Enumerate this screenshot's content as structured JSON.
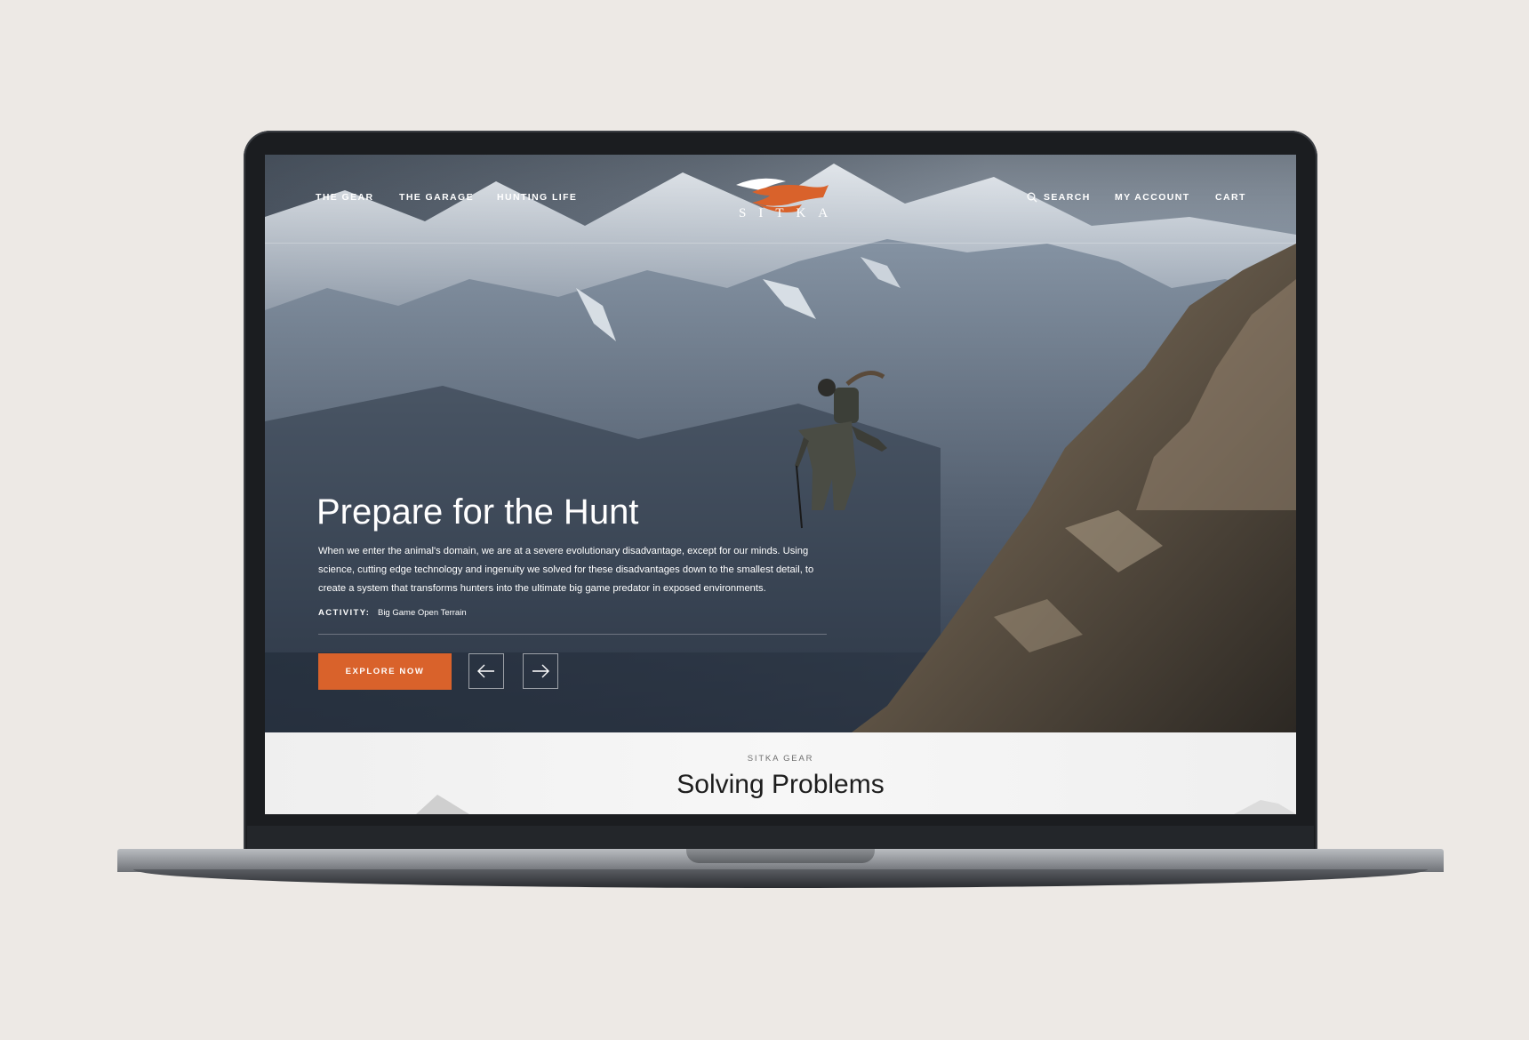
{
  "colors": {
    "accent": "#d9622b",
    "page_background": "#ede9e5"
  },
  "nav": {
    "left": [
      {
        "label": "THE GEAR"
      },
      {
        "label": "THE GARAGE"
      },
      {
        "label": "HUNTING LIFE"
      }
    ],
    "search_label": "SEARCH",
    "search_icon": "search-icon",
    "account_label": "MY ACCOUNT",
    "cart_label": "CART"
  },
  "logo": {
    "text": "SITKA"
  },
  "hero": {
    "title": "Prepare for the Hunt",
    "description": "When we enter the animal's domain, we are at a severe evolutionary disadvantage, except for our minds. Using science, cutting edge technology and ingenuity we solved for these disadvantages down to the smallest detail, to create a system that transforms hunters into the ultimate big game predator in exposed environments.",
    "activity_label": "ACTIVITY:",
    "activity_value": "Big Game Open Terrain",
    "cta_label": "EXPLORE NOW",
    "prev_icon": "arrow-left-icon",
    "next_icon": "arrow-right-icon"
  },
  "section": {
    "eyebrow": "SITKA GEAR",
    "title": "Solving Problems"
  }
}
